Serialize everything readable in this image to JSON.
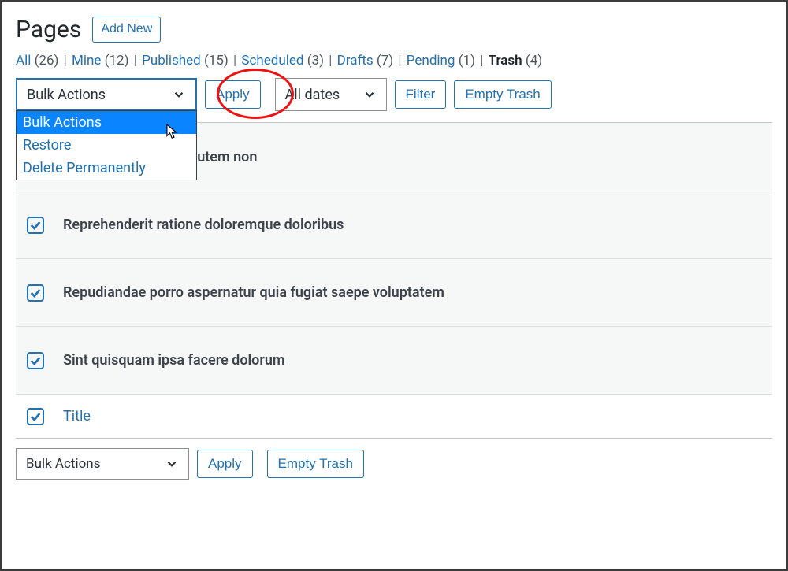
{
  "header": {
    "title": "Pages",
    "add_new": "Add New"
  },
  "filters": {
    "items": [
      {
        "label": "All",
        "count": "(26)"
      },
      {
        "label": "Mine",
        "count": "(12)"
      },
      {
        "label": "Published",
        "count": "(15)"
      },
      {
        "label": "Scheduled",
        "count": "(3)"
      },
      {
        "label": "Drafts",
        "count": "(7)"
      },
      {
        "label": "Pending",
        "count": "(1)"
      },
      {
        "label": "Trash",
        "count": "(4)",
        "current": true
      }
    ]
  },
  "toolbar_top": {
    "bulk_action": {
      "selected": "Bulk Actions",
      "options": [
        "Bulk Actions",
        "Restore",
        "Delete Permanently"
      ]
    },
    "apply": "Apply",
    "date_filter": "All dates",
    "filter": "Filter",
    "empty_trash": "Empty Trash"
  },
  "rows": [
    {
      "title": "Quia doloribus quia autem non"
    },
    {
      "title": "Reprehenderit ratione doloremque doloribus"
    },
    {
      "title": "Repudiandae porro aspernatur quia fugiat saepe voluptatem"
    },
    {
      "title": "Sint quisquam ipsa facere dolorum"
    }
  ],
  "column_header": {
    "title": "Title"
  },
  "toolbar_bottom": {
    "bulk_action": "Bulk Actions",
    "apply": "Apply",
    "empty_trash": "Empty Trash"
  }
}
